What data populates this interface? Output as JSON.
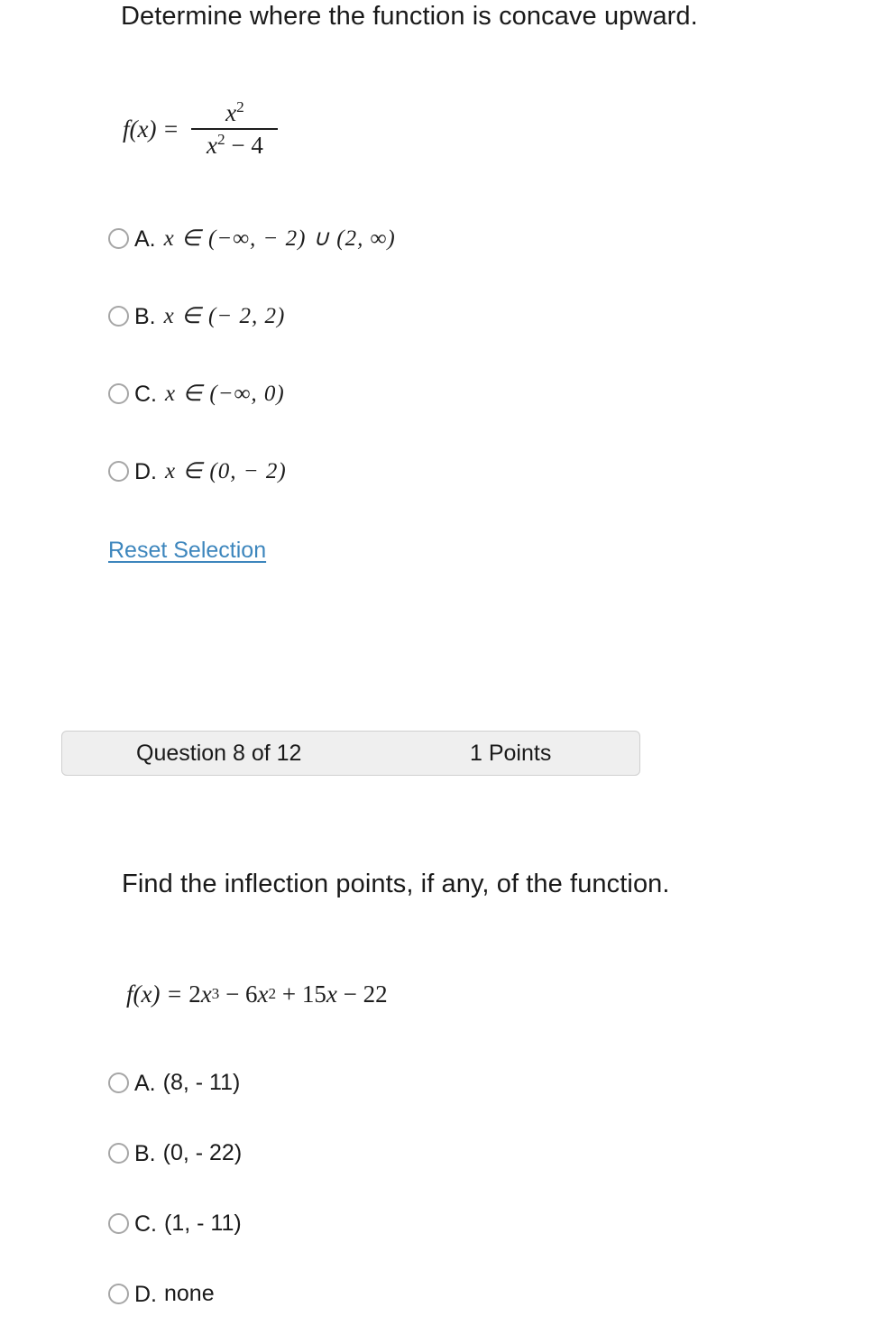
{
  "page": {
    "background": "#ffffff",
    "link_color": "#3d86bd",
    "bar_background": "#efefef",
    "bar_border": "#cfcfcf"
  },
  "question_1": {
    "prompt": "Determine where the function is concave upward.",
    "formula": {
      "lhs": "f(x) =",
      "numerator_base": "x",
      "numerator_exp": "2",
      "denominator_base": "x",
      "denominator_exp": "2",
      "denominator_rest": "− 4"
    },
    "options": [
      {
        "letter": "A.",
        "value": "x ∈ (−∞, − 2) ∪ (2, ∞)",
        "selected": false
      },
      {
        "letter": "B.",
        "value": "x ∈ (− 2, 2)",
        "selected": false
      },
      {
        "letter": "C.",
        "value": "x ∈ (−∞, 0)",
        "selected": false
      },
      {
        "letter": "D.",
        "value": "x ∈ (0, − 2)",
        "selected": false
      }
    ],
    "reset_label": "Reset Selection"
  },
  "status_bar": {
    "counter": "Question 8 of 12",
    "points": "1 Points"
  },
  "question_2": {
    "prompt": "Find the inflection points, if any, of the function.",
    "formula": {
      "lhs": "f(x) =",
      "term_1_coef": "2",
      "term_1_base": "x",
      "term_1_exp": "3",
      "op_1": "−",
      "term_2_coef": "6",
      "term_2_base": "x",
      "term_2_exp": "2",
      "op_2": "+",
      "term_3": "15",
      "term_3_base": "x",
      "op_3": "−",
      "term_4": "22"
    },
    "options": [
      {
        "letter": "A.",
        "value": "(8, - 11)",
        "selected": false
      },
      {
        "letter": "B.",
        "value": "(0, - 22)",
        "selected": false
      },
      {
        "letter": "C.",
        "value": "(1, - 11)",
        "selected": false
      },
      {
        "letter": "D.",
        "value": "none",
        "selected": false
      }
    ]
  }
}
